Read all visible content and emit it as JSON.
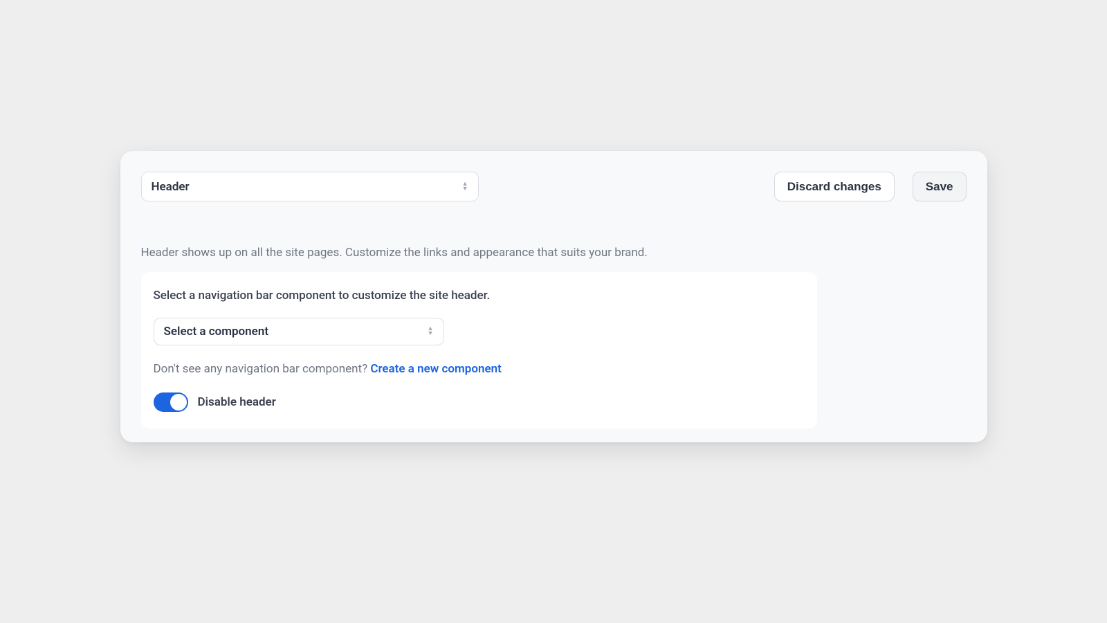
{
  "topbar": {
    "page_select": "Header",
    "discard_label": "Discard changes",
    "save_label": "Save"
  },
  "description": "Header shows up on all the site pages. Customize the links and appearance that suits your brand.",
  "card": {
    "title": "Select a navigation bar component to customize the site header.",
    "component_select": "Select a component",
    "helper_prefix": "Don't see any navigation bar component? ",
    "helper_link": "Create a new component",
    "toggle_label": "Disable header",
    "toggle_on": true
  },
  "colors": {
    "accent": "#1c64e0"
  }
}
